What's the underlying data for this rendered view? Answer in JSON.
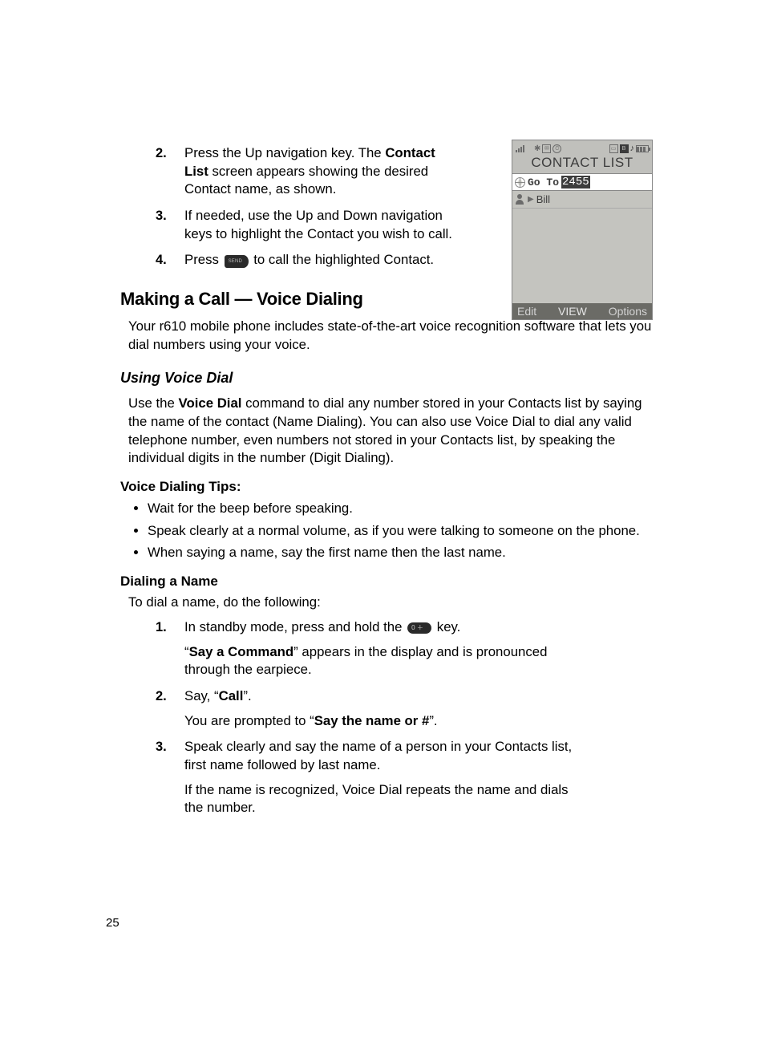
{
  "steps_top": [
    {
      "num": "2.",
      "pre": "Press the Up navigation key. The ",
      "bold": "Contact List",
      "post": " screen appears showing the desired Contact name, as shown."
    },
    {
      "num": "3.",
      "pre": "If needed, use the Up and Down navigation keys to highlight the Contact you wish to call.",
      "bold": "",
      "post": ""
    },
    {
      "num": "4.",
      "pre": "Press ",
      "bold": "",
      "post": " to call the highlighted Contact.",
      "icon": "send"
    }
  ],
  "screenshot": {
    "title": "CONTACT LIST",
    "goto_label": "Go To",
    "goto_value": "2455",
    "row_name": "Bill",
    "softkeys": {
      "left": "Edit",
      "center": "VIEW",
      "right": "Options"
    }
  },
  "h_voice": "Making a Call — Voice Dialing",
  "p_voice": "Your r610 mobile phone includes state-of-the-art voice recognition software that lets you dial numbers using your voice.",
  "h_using": "Using Voice Dial",
  "p_using_pre": "Use the ",
  "p_using_bold": "Voice Dial",
  "p_using_post": " command to dial any number stored in your Contacts list by saying the name of the contact (Name Dialing). You can also use Voice Dial to dial any valid telephone number, even numbers not stored in your Contacts list, by speaking the individual digits in the number (Digit Dialing).",
  "h_tips": "Voice Dialing Tips:",
  "tips": [
    "Wait for the beep before speaking.",
    "Speak clearly at a normal volume, as if you were talking to someone on the phone.",
    "When saying a name, say the first name then the last name."
  ],
  "h_dialname": "Dialing a Name",
  "p_dialname_intro": "To dial a name, do the following:",
  "steps_name": [
    {
      "num": "1.",
      "line_pre": "In standby mode, press and hold the ",
      "line_post": " key.",
      "icon": "zero",
      "sub_pre": "“",
      "sub_bold": "Say a Command",
      "sub_post": "” appears in the display and is pronounced through the earpiece."
    },
    {
      "num": "2.",
      "line_pre": "Say, “",
      "line_bold": "Call",
      "line_post": "”.",
      "sub_pre": "You are prompted to “",
      "sub_bold": "Say the name or #",
      "sub_post": "”."
    },
    {
      "num": "3.",
      "line_pre": "Speak clearly and say the name of a person in your Contacts list, first name followed by last name.",
      "sub_pre": "If the name is recognized, Voice Dial repeats the name and dials the number.",
      "sub_bold": "",
      "sub_post": ""
    }
  ],
  "page_number": "25"
}
